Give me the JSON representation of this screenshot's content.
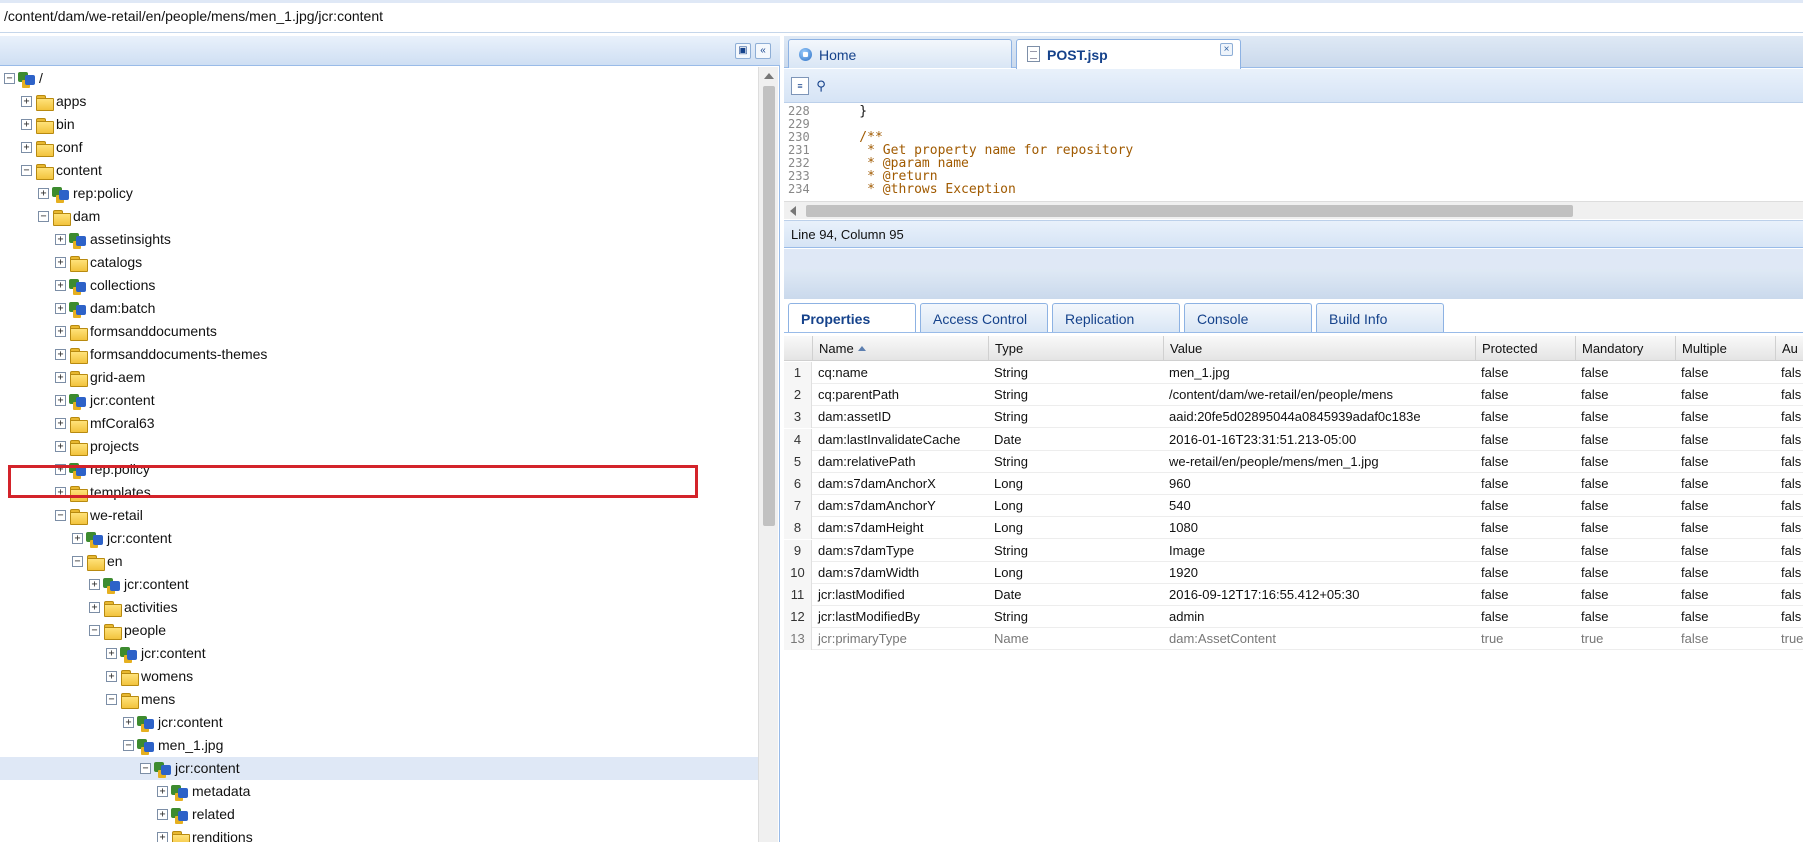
{
  "address": {
    "path": "/content/dam/we-retail/en/people/mens/men_1.jpg/jcr:content"
  },
  "tree": {
    "nodes": [
      {
        "label": "/",
        "depth": 0,
        "toggle": "minus",
        "icon": "node"
      },
      {
        "label": "apps",
        "depth": 1,
        "toggle": "plus",
        "icon": "folder"
      },
      {
        "label": "bin",
        "depth": 1,
        "toggle": "plus",
        "icon": "folder"
      },
      {
        "label": "conf",
        "depth": 1,
        "toggle": "plus",
        "icon": "folder"
      },
      {
        "label": "content",
        "depth": 1,
        "toggle": "minus",
        "icon": "folder"
      },
      {
        "label": "rep:policy",
        "depth": 2,
        "toggle": "plus",
        "icon": "node"
      },
      {
        "label": "dam",
        "depth": 2,
        "toggle": "minus",
        "icon": "folder"
      },
      {
        "label": "assetinsights",
        "depth": 3,
        "toggle": "plus",
        "icon": "node"
      },
      {
        "label": "catalogs",
        "depth": 3,
        "toggle": "plus",
        "icon": "folder"
      },
      {
        "label": "collections",
        "depth": 3,
        "toggle": "plus",
        "icon": "node"
      },
      {
        "label": "dam:batch",
        "depth": 3,
        "toggle": "plus",
        "icon": "node"
      },
      {
        "label": "formsanddocuments",
        "depth": 3,
        "toggle": "plus",
        "icon": "folder"
      },
      {
        "label": "formsanddocuments-themes",
        "depth": 3,
        "toggle": "plus",
        "icon": "folder"
      },
      {
        "label": "grid-aem",
        "depth": 3,
        "toggle": "plus",
        "icon": "folder"
      },
      {
        "label": "jcr:content",
        "depth": 3,
        "toggle": "plus",
        "icon": "node"
      },
      {
        "label": "mfCoral63",
        "depth": 3,
        "toggle": "plus",
        "icon": "folder"
      },
      {
        "label": "projects",
        "depth": 3,
        "toggle": "plus",
        "icon": "folder"
      },
      {
        "label": "rep:policy",
        "depth": 3,
        "toggle": "plus",
        "icon": "node"
      },
      {
        "label": "templates",
        "depth": 3,
        "toggle": "plus",
        "icon": "folder"
      },
      {
        "label": "we-retail",
        "depth": 3,
        "toggle": "minus",
        "icon": "folder"
      },
      {
        "label": "jcr:content",
        "depth": 4,
        "toggle": "plus",
        "icon": "node"
      },
      {
        "label": "en",
        "depth": 4,
        "toggle": "minus",
        "icon": "folder"
      },
      {
        "label": "jcr:content",
        "depth": 5,
        "toggle": "plus",
        "icon": "node"
      },
      {
        "label": "activities",
        "depth": 5,
        "toggle": "plus",
        "icon": "folder"
      },
      {
        "label": "people",
        "depth": 5,
        "toggle": "minus",
        "icon": "folder"
      },
      {
        "label": "jcr:content",
        "depth": 6,
        "toggle": "plus",
        "icon": "node"
      },
      {
        "label": "womens",
        "depth": 6,
        "toggle": "plus",
        "icon": "folder"
      },
      {
        "label": "mens",
        "depth": 6,
        "toggle": "minus",
        "icon": "folder"
      },
      {
        "label": "jcr:content",
        "depth": 7,
        "toggle": "plus",
        "icon": "node"
      },
      {
        "label": "men_1.jpg",
        "depth": 7,
        "toggle": "minus",
        "icon": "node"
      },
      {
        "label": "jcr:content",
        "depth": 8,
        "toggle": "minus",
        "icon": "node",
        "selected": true
      },
      {
        "label": "metadata",
        "depth": 9,
        "toggle": "plus",
        "icon": "node"
      },
      {
        "label": "related",
        "depth": 9,
        "toggle": "plus",
        "icon": "node"
      },
      {
        "label": "renditions",
        "depth": 9,
        "toggle": "plus",
        "icon": "folder"
      }
    ]
  },
  "editor": {
    "tabs": [
      {
        "label": "Home"
      },
      {
        "label": "POST.jsp",
        "closable": "×"
      }
    ],
    "code_lines": [
      {
        "num": "228",
        "text": "    }",
        "comment": false
      },
      {
        "num": "229",
        "text": "",
        "comment": false
      },
      {
        "num": "230",
        "text": "    /**",
        "comment": true
      },
      {
        "num": "231",
        "text": "     * Get property name for repository",
        "comment": true
      },
      {
        "num": "232",
        "text": "     * @param name",
        "comment": true
      },
      {
        "num": "233",
        "text": "     * @return",
        "comment": true
      },
      {
        "num": "234",
        "text": "     * @throws Exception",
        "comment": true
      }
    ],
    "status": "Line 94, Column 95"
  },
  "bottom_tabs": [
    "Properties",
    "Access Control",
    "Replication",
    "Console",
    "Build Info"
  ],
  "properties": {
    "columns": [
      "Name",
      "Type",
      "Value",
      "Protected",
      "Mandatory",
      "Multiple",
      "Au"
    ],
    "rows": [
      {
        "n": "1",
        "name": "cq:name",
        "type": "String",
        "value": "men_1.jpg",
        "protected": "false",
        "mandatory": "false",
        "multiple": "false",
        "auto": "fals"
      },
      {
        "n": "2",
        "name": "cq:parentPath",
        "type": "String",
        "value": "/content/dam/we-retail/en/people/mens",
        "protected": "false",
        "mandatory": "false",
        "multiple": "false",
        "auto": "fals"
      },
      {
        "n": "3",
        "name": "dam:assetID",
        "type": "String",
        "value": "aaid:20fe5d02895044a0845939adaf0c183e",
        "protected": "false",
        "mandatory": "false",
        "multiple": "false",
        "auto": "fals"
      },
      {
        "n": "4",
        "name": "dam:lastInvalidateCache",
        "type": "Date",
        "value": "2016-01-16T23:31:51.213-05:00",
        "protected": "false",
        "mandatory": "false",
        "multiple": "false",
        "auto": "fals"
      },
      {
        "n": "5",
        "name": "dam:relativePath",
        "type": "String",
        "value": "we-retail/en/people/mens/men_1.jpg",
        "protected": "false",
        "mandatory": "false",
        "multiple": "false",
        "auto": "fals"
      },
      {
        "n": "6",
        "name": "dam:s7damAnchorX",
        "type": "Long",
        "value": "960",
        "protected": "false",
        "mandatory": "false",
        "multiple": "false",
        "auto": "fals"
      },
      {
        "n": "7",
        "name": "dam:s7damAnchorY",
        "type": "Long",
        "value": "540",
        "protected": "false",
        "mandatory": "false",
        "multiple": "false",
        "auto": "fals"
      },
      {
        "n": "8",
        "name": "dam:s7damHeight",
        "type": "Long",
        "value": "1080",
        "protected": "false",
        "mandatory": "false",
        "multiple": "false",
        "auto": "fals"
      },
      {
        "n": "9",
        "name": "dam:s7damType",
        "type": "String",
        "value": "Image",
        "protected": "false",
        "mandatory": "false",
        "multiple": "false",
        "auto": "fals"
      },
      {
        "n": "10",
        "name": "dam:s7damWidth",
        "type": "Long",
        "value": "1920",
        "protected": "false",
        "mandatory": "false",
        "multiple": "false",
        "auto": "fals"
      },
      {
        "n": "11",
        "name": "jcr:lastModified",
        "type": "Date",
        "value": "2016-09-12T17:16:55.412+05:30",
        "protected": "false",
        "mandatory": "false",
        "multiple": "false",
        "auto": "fals"
      },
      {
        "n": "12",
        "name": "jcr:lastModifiedBy",
        "type": "String",
        "value": "admin",
        "protected": "false",
        "mandatory": "false",
        "multiple": "false",
        "auto": "fals"
      },
      {
        "n": "13",
        "name": "jcr:primaryType",
        "type": "Name",
        "value": "dam:AssetContent",
        "protected": "true",
        "mandatory": "true",
        "multiple": "false",
        "auto": "true",
        "dim": true
      }
    ]
  },
  "highlight": {
    "color": "#d3232a"
  }
}
